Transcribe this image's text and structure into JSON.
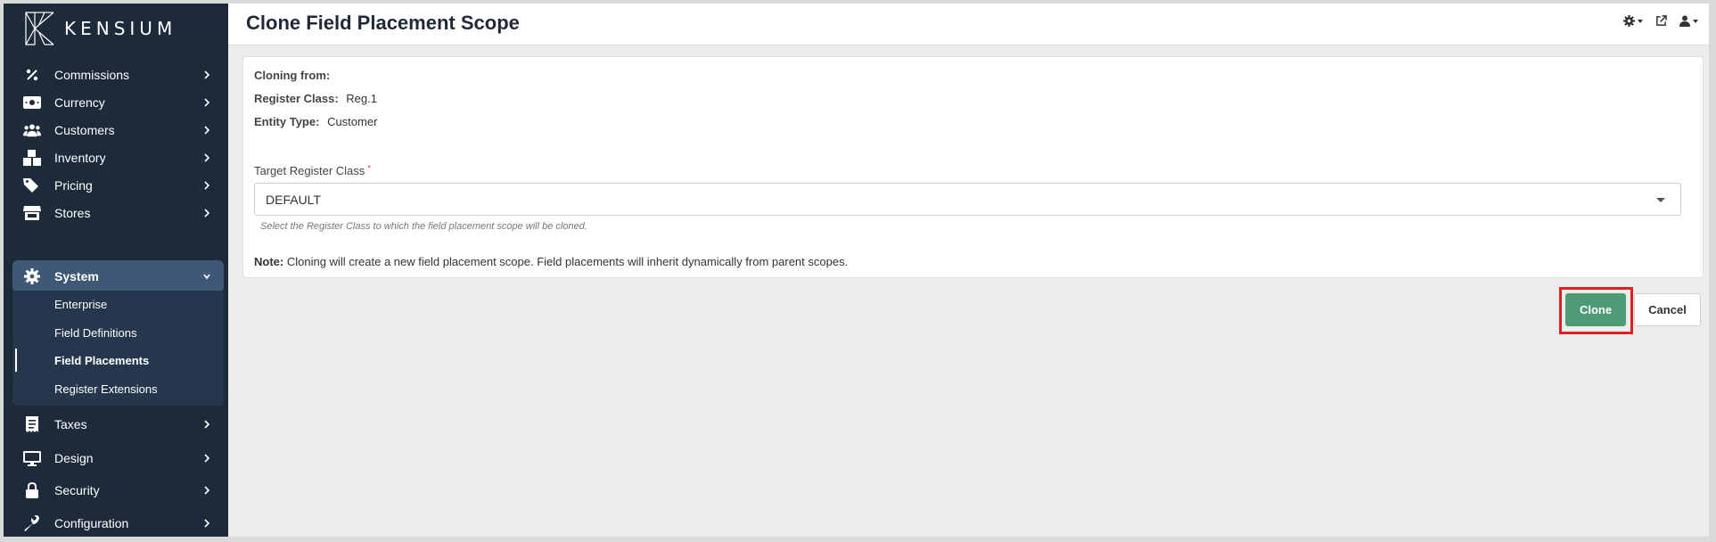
{
  "brand": {
    "name": "KENSIUM"
  },
  "header": {
    "title": "Clone Field Placement Scope",
    "tools": [
      {
        "icon": "gear-icon",
        "has_caret": true
      },
      {
        "icon": "external-link-icon",
        "has_caret": false
      },
      {
        "icon": "user-icon",
        "has_caret": true
      }
    ]
  },
  "sidebar": {
    "items": [
      {
        "label": "Commissions",
        "icon": "percent-icon"
      },
      {
        "label": "Currency",
        "icon": "money-icon"
      },
      {
        "label": "Customers",
        "icon": "users-icon"
      },
      {
        "label": "Inventory",
        "icon": "boxes-icon"
      },
      {
        "label": "Pricing",
        "icon": "tags-icon"
      },
      {
        "label": "Stores",
        "icon": "store-icon"
      },
      {
        "label": "System",
        "icon": "gear-icon",
        "expanded": true
      },
      {
        "label": "Taxes",
        "icon": "receipt-icon"
      },
      {
        "label": "Design",
        "icon": "monitor-icon"
      },
      {
        "label": "Security",
        "icon": "lock-icon"
      },
      {
        "label": "Configuration",
        "icon": "wrench-icon"
      }
    ],
    "system_submenu": [
      {
        "label": "Enterprise"
      },
      {
        "label": "Field Definitions"
      },
      {
        "label": "Field Placements",
        "current": true
      },
      {
        "label": "Register Extensions"
      }
    ]
  },
  "form": {
    "cloning_from_label": "Cloning from:",
    "register_class_label": "Register Class:",
    "register_class_value": "Reg.1",
    "entity_type_label": "Entity Type:",
    "entity_type_value": "Customer",
    "target_label": "Target Register Class",
    "target_required_mark": "*",
    "target_value": "DEFAULT",
    "target_help": "Select the Register Class to which the field placement scope will be cloned.",
    "note_label": "Note:",
    "note_text": "Cloning will create a new field placement scope. Field placements will inherit dynamically from parent scopes."
  },
  "actions": {
    "clone_label": "Clone",
    "cancel_label": "Cancel"
  },
  "colors": {
    "sidebar_bg": "#1d2a3a",
    "active_item_bg": "#3f5875",
    "clone_button": "#4e9a74",
    "highlight_box": "#e02020"
  }
}
